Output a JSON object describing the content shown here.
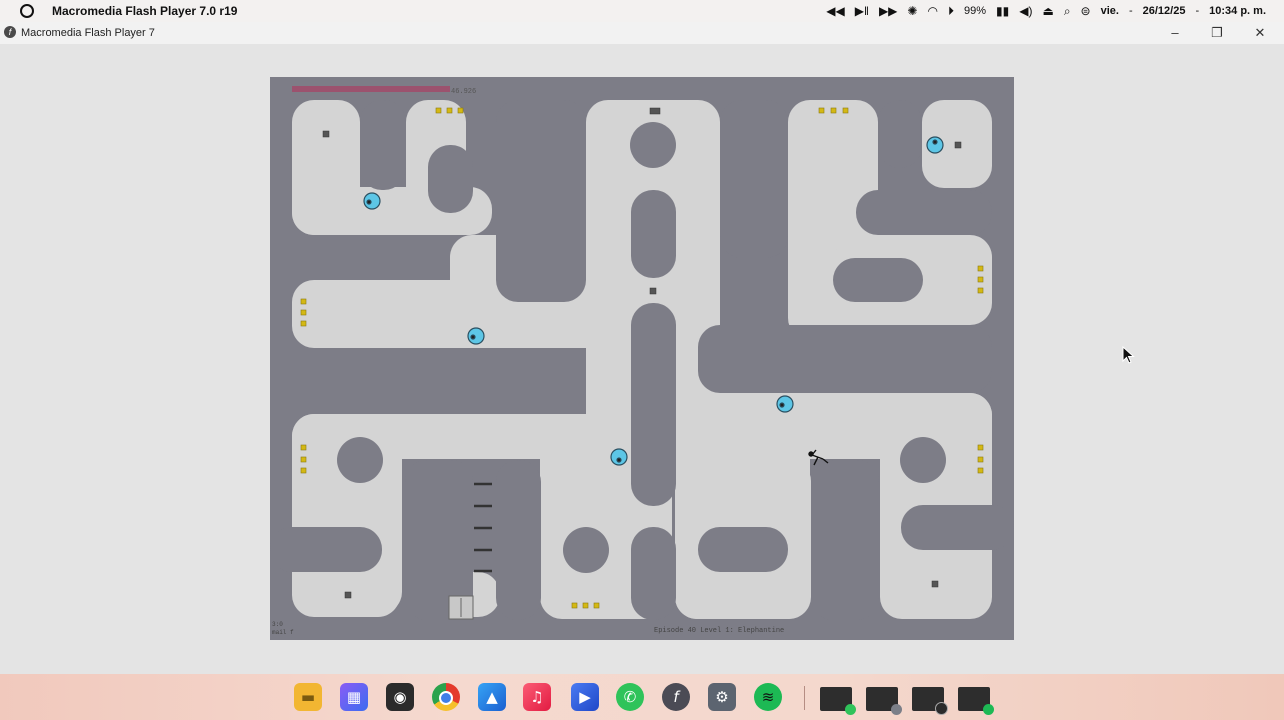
{
  "menubar": {
    "app_title": "Macromedia Flash Player 7.0  r19",
    "battery_percent": "99%",
    "day": "vie.",
    "date": "26/12/25",
    "time": "10:34 p. m.",
    "separator": "-"
  },
  "window": {
    "title": "Macromedia Flash Player 7"
  },
  "game": {
    "time_readout": "46.926",
    "time_bar_fraction": 0.66,
    "level_caption": "Episode 40 Level 1: Elephantine",
    "corner_caption_line1": "3:0",
    "corner_caption_line2": "mail f"
  },
  "colors": {
    "wall": "#7d7d87",
    "floor": "#d4d4d4",
    "gold": "#d4b814",
    "drone": "#5dc6e6",
    "time_bar": "#9c526e",
    "page_bg": "#e4e4e4"
  },
  "taskbar": {
    "apps": [
      {
        "icon": "folder-icon",
        "label": "Files"
      },
      {
        "icon": "start-grid-icon",
        "label": "Start"
      },
      {
        "icon": "obs-icon",
        "label": "OBS"
      },
      {
        "icon": "chrome-icon",
        "label": "Chrome"
      },
      {
        "icon": "photos-icon",
        "label": "Photos"
      },
      {
        "icon": "music-icon",
        "label": "Music"
      },
      {
        "icon": "player-icon",
        "label": "Player"
      },
      {
        "icon": "whatsapp-icon",
        "label": "WhatsApp"
      },
      {
        "icon": "flash-icon",
        "label": "Flash Player"
      },
      {
        "icon": "settings-icon",
        "label": "Settings"
      },
      {
        "icon": "spotify-icon",
        "label": "Spotify"
      }
    ]
  }
}
